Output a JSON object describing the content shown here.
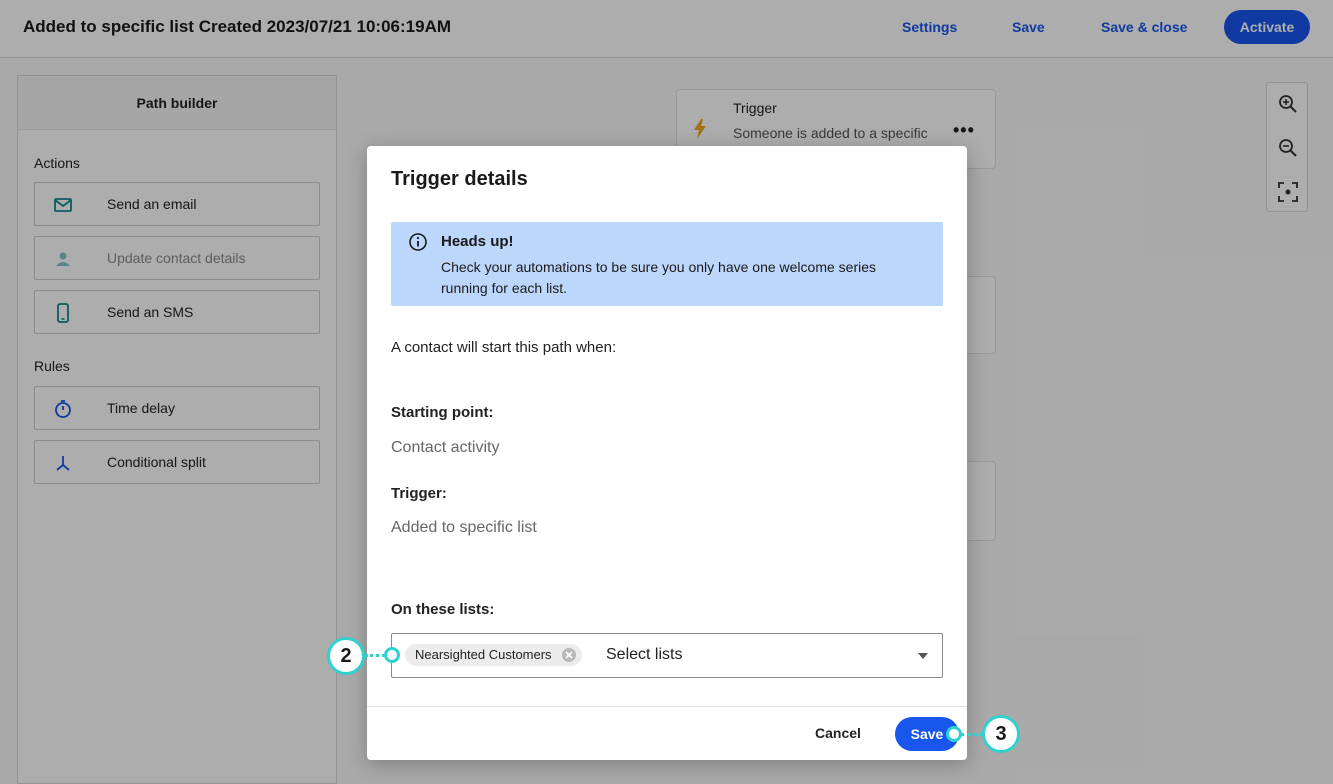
{
  "header": {
    "title": "Added to specific list Created 2023/07/21 10:06:19AM",
    "settings": "Settings",
    "save": "Save",
    "save_close": "Save & close",
    "activate": "Activate"
  },
  "sidebar": {
    "title": "Path builder",
    "actions_label": "Actions",
    "rules_label": "Rules",
    "actions": [
      {
        "label": "Send an email",
        "icon": "envelope-icon"
      },
      {
        "label": "Update contact details",
        "icon": "person-icon"
      },
      {
        "label": "Send an SMS",
        "icon": "phone-icon"
      }
    ],
    "rules": [
      {
        "label": "Time delay",
        "icon": "stopwatch-icon"
      },
      {
        "label": "Conditional split",
        "icon": "split-icon"
      }
    ]
  },
  "canvas": {
    "trigger_node": {
      "title": "Trigger",
      "text": "Someone is added to a specific",
      "more": "•••"
    }
  },
  "modal": {
    "title": "Trigger details",
    "alert_title": "Heads up!",
    "alert_text": "Check your automations to be sure you only have one welcome series running for each list.",
    "intro": "A contact will start this path when:",
    "starting_point_label": "Starting point:",
    "starting_point_value": "Contact activity",
    "trigger_label": "Trigger:",
    "trigger_value": "Added to specific list",
    "lists_label": "On these lists:",
    "selected_list": "Nearsighted Customers",
    "select_placeholder": "Select lists",
    "cancel": "Cancel",
    "save": "Save"
  },
  "callouts": {
    "step2": "2",
    "step3": "3"
  },
  "colors": {
    "accent": "#1856ed",
    "alert_bg": "#bcd7fb",
    "callout": "#2ed1cc"
  }
}
